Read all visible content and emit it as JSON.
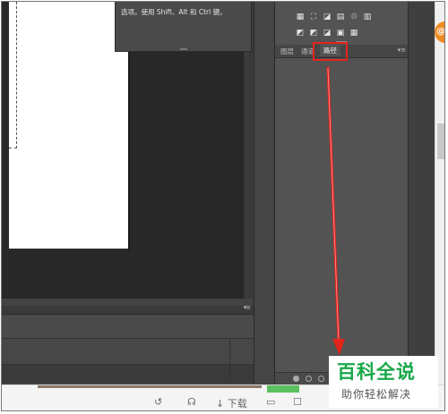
{
  "tooltip": {
    "text": "选项。使用 Shift、Alt 和 Ctrl 键。"
  },
  "panel": {
    "tabs": [
      {
        "label": "图层"
      },
      {
        "label": "通道"
      },
      {
        "label": "路径"
      }
    ],
    "menu_glyph": "▾≡",
    "active_tab": "路径",
    "icons_row1": [
      "levels-icon",
      "curves-icon",
      "exposure-icon",
      "vibrance-icon",
      "hue-saturation-icon",
      "color-balance-icon"
    ],
    "icons_row2": [
      "invert-icon",
      "posterize-icon",
      "threshold-icon",
      "gradient-map-icon",
      "selective-color-icon"
    ]
  },
  "bottom_panel": {
    "menu_glyph": "▾≡"
  },
  "highlight": {
    "color": "#e2231a"
  },
  "annotation_arrow": {
    "color": "#e2231a"
  },
  "taskbar": {
    "feedback_icon": "↺",
    "like_icon": "☊",
    "download_label": "↓ 下载",
    "comment_icon": "▭",
    "share_icon": "☐"
  },
  "badge": {
    "label": "@"
  },
  "watermark": {
    "title": "百科全说",
    "subtitle": "助你轻松解决",
    "color": "#19a84a"
  }
}
